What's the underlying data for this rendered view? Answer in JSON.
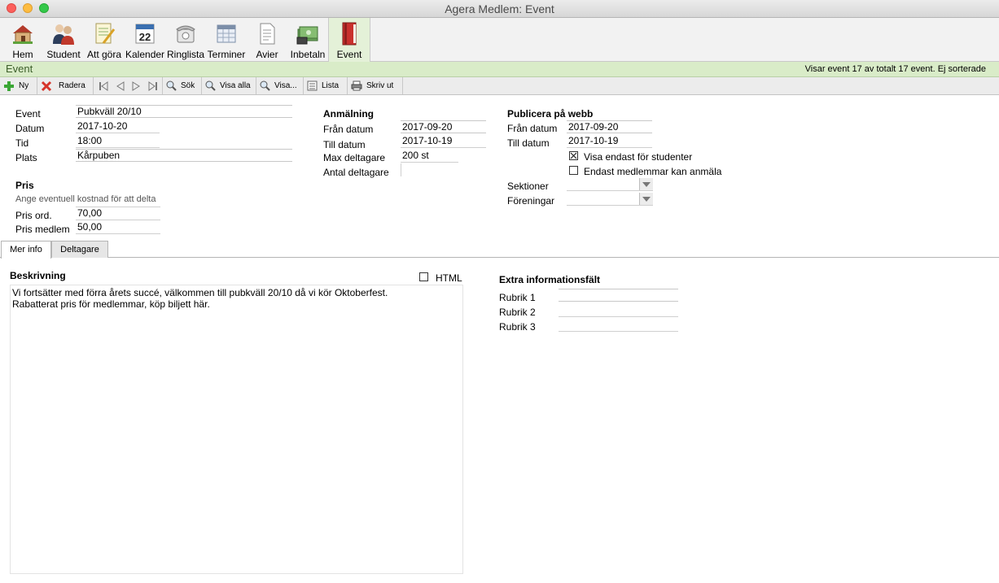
{
  "window": {
    "title": "Agera Medlem: Event"
  },
  "toolbar": {
    "items": [
      {
        "label": "Hem",
        "icon": "house-icon"
      },
      {
        "label": "Student",
        "icon": "people-icon"
      },
      {
        "label": "Att göra",
        "icon": "notepad-icon"
      },
      {
        "label": "Kalender",
        "icon": "calendar-icon"
      },
      {
        "label": "Ringlista",
        "icon": "phone-icon"
      },
      {
        "label": "Terminer",
        "icon": "grid-calendar-icon"
      },
      {
        "label": "Avier",
        "icon": "document-icon"
      },
      {
        "label": "Inbetaln",
        "icon": "money-icon"
      },
      {
        "label": "Event",
        "icon": "book-icon"
      }
    ],
    "calendar_day": "22",
    "active": "Event"
  },
  "section": {
    "name": "Event",
    "status": "Visar event 17 av totalt 17 event. Ej sorterade"
  },
  "record_toolbar": {
    "new": "Ny",
    "delete": "Radera",
    "search": "Sök",
    "show_all": "Visa alla",
    "show": "Visa...",
    "list": "Lista",
    "print": "Skriv ut"
  },
  "event": {
    "event_label": "Event",
    "event_value": "Pubkväll 20/10",
    "date_label": "Datum",
    "date_value": "2017-10-20",
    "time_label": "Tid",
    "time_value": "18:00",
    "place_label": "Plats",
    "place_value": "Kårpuben"
  },
  "price": {
    "heading": "Pris",
    "hint": "Ange eventuell kostnad för att delta",
    "ord_label": "Pris ord.",
    "ord_value": "70,00",
    "member_label": "Pris medlem",
    "member_value": "50,00"
  },
  "registration": {
    "heading": "Anmälning",
    "from_label": "Från datum",
    "from_value": "2017-09-20",
    "to_label": "Till datum",
    "to_value": "2017-10-19",
    "max_label": "Max deltagare",
    "max_value": "200 st",
    "count_label": "Antal deltagare",
    "count_value": ""
  },
  "publish": {
    "heading": "Publicera på webb",
    "from_label": "Från datum",
    "from_value": "2017-09-20",
    "to_label": "Till datum",
    "to_value": "2017-10-19",
    "students_only_label": "Visa endast för studenter",
    "students_only_checked": true,
    "members_only_label": "Endast medlemmar kan anmäla",
    "members_only_checked": false,
    "sections_label": "Sektioner",
    "sections_value": "",
    "associations_label": "Föreningar",
    "associations_value": ""
  },
  "tabs": [
    {
      "label": "Mer info"
    },
    {
      "label": "Deltagare"
    }
  ],
  "description": {
    "heading": "Beskrivning",
    "html_label": "HTML",
    "html_checked": false,
    "line1": "Vi fortsätter med förra årets succé, välkommen till pubkväll 20/10 då vi kör Oktoberfest.",
    "line2": "Rabatterat pris för medlemmar, köp biljett här."
  },
  "extra": {
    "heading": "Extra informationsfält",
    "fields": [
      {
        "label": "Rubrik 1",
        "value": ""
      },
      {
        "label": "Rubrik 2",
        "value": ""
      },
      {
        "label": "Rubrik 3",
        "value": ""
      }
    ]
  },
  "colors": {
    "section_bar": "#d9ecc8",
    "active_tab": "#e4f1d8",
    "delete_red": "#d6342a",
    "add_green": "#3aa635"
  }
}
